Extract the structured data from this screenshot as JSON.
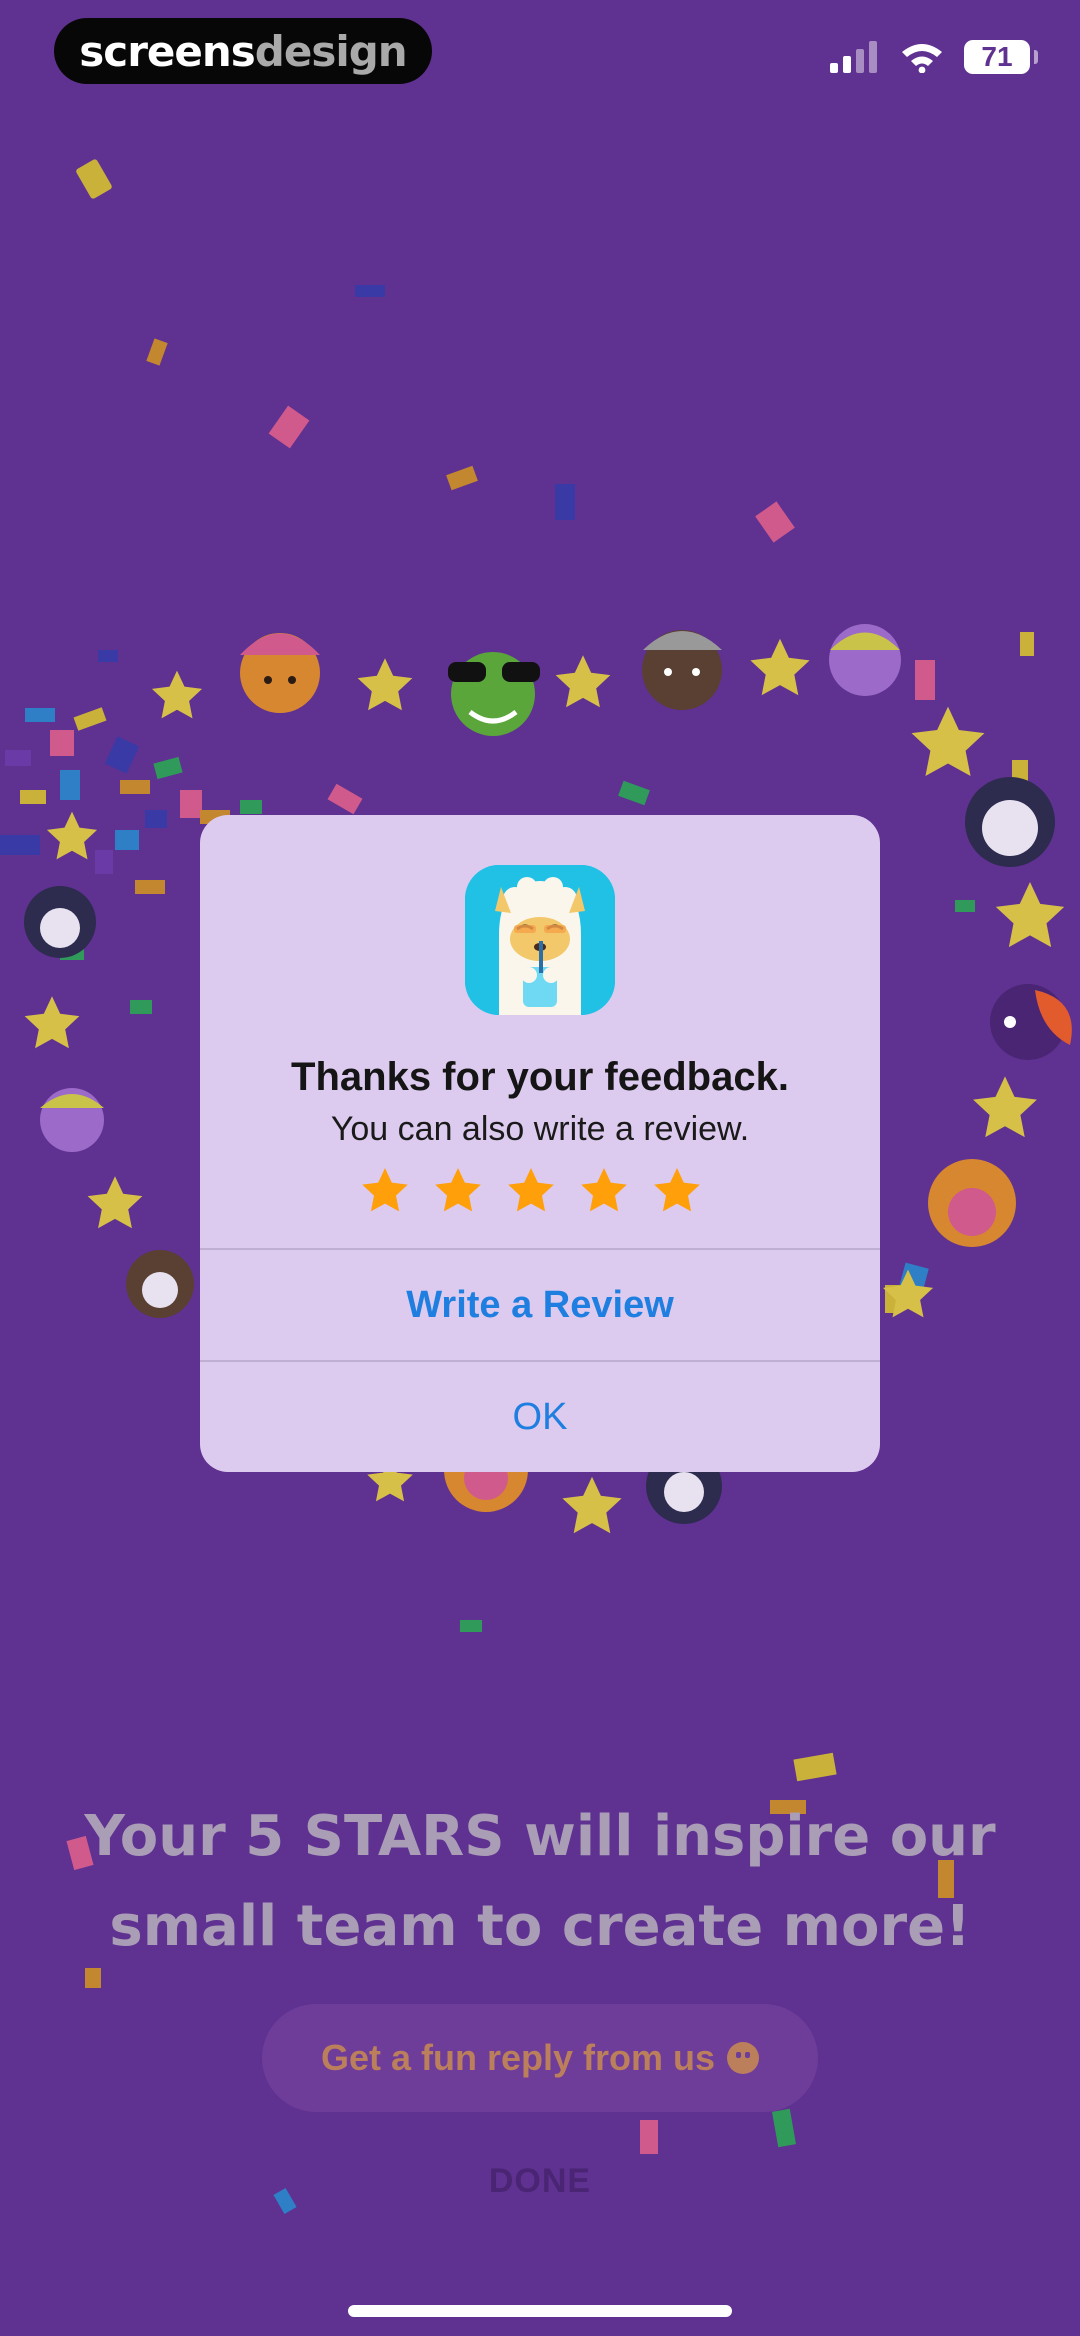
{
  "status_bar": {
    "brand_part1": "screens",
    "brand_part2": "design",
    "battery_level": "71",
    "icons": [
      "cellular-signal-icon",
      "wifi-icon",
      "battery-icon"
    ]
  },
  "dialog": {
    "title": "Thanks for your feedback.",
    "subtitle": "You can also write a review.",
    "star_rating": 5,
    "star_max": 5,
    "star_color": "#ff9f0a",
    "write_review_label": "Write a Review",
    "ok_label": "OK",
    "action_color": "#1f7fe0",
    "app_icon": "alpaca-app-icon"
  },
  "page": {
    "headline_line1": "Your 5 STARS will inspire our",
    "headline_line2": "small team to create more!",
    "fun_reply_label": "Get a fun reply from us",
    "fun_reply_icon": "smiley-icon",
    "done_label": "DONE",
    "background_color": "#5f3191"
  }
}
